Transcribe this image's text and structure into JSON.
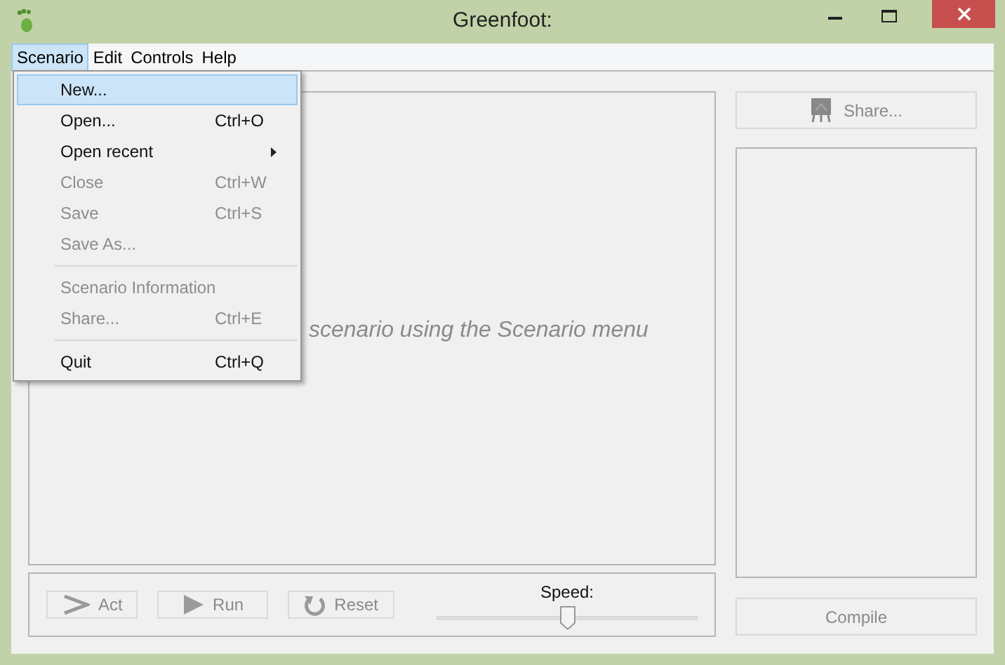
{
  "window": {
    "title": "Greenfoot:"
  },
  "menu_bar": [
    {
      "label": "Scenario",
      "selected": true
    },
    {
      "label": "Edit",
      "selected": false
    },
    {
      "label": "Controls",
      "selected": false
    },
    {
      "label": "Help",
      "selected": false
    }
  ],
  "menu": [
    {
      "kind": "item",
      "label": "New...",
      "disabled": false,
      "selected": true
    },
    {
      "kind": "item",
      "label": "Open...",
      "shortcut": "Ctrl+O",
      "disabled": false,
      "selected": false
    },
    {
      "kind": "submenu",
      "label": "Open recent",
      "disabled": false,
      "selected": false
    },
    {
      "kind": "item",
      "label": "Close",
      "shortcut": "Ctrl+W",
      "disabled": true,
      "selected": false
    },
    {
      "kind": "item",
      "label": "Save",
      "shortcut": "Ctrl+S",
      "disabled": true,
      "selected": false
    },
    {
      "kind": "item",
      "label": "Save As...",
      "disabled": true,
      "selected": false
    },
    {
      "kind": "separator"
    },
    {
      "kind": "item",
      "label": "Scenario Information",
      "disabled": true,
      "selected": false
    },
    {
      "kind": "item",
      "label": "Share...",
      "shortcut": "Ctrl+E",
      "disabled": true,
      "selected": false
    },
    {
      "kind": "separator"
    },
    {
      "kind": "item",
      "label": "Quit",
      "shortcut": "Ctrl+Q",
      "disabled": false,
      "selected": false
    }
  ],
  "world_message": "scenario using the Scenario menu",
  "controls": [
    {
      "kind": "act",
      "label": "Act",
      "disabled": true
    },
    {
      "kind": "run",
      "label": "Run",
      "disabled": true
    },
    {
      "kind": "reset",
      "label": "Reset",
      "disabled": true
    }
  ],
  "speed": {
    "label": "Speed:",
    "level": 0.5
  },
  "share_button": {
    "label": "Share...",
    "disabled": true
  },
  "compile_button": {
    "label": "Compile",
    "disabled": true
  }
}
